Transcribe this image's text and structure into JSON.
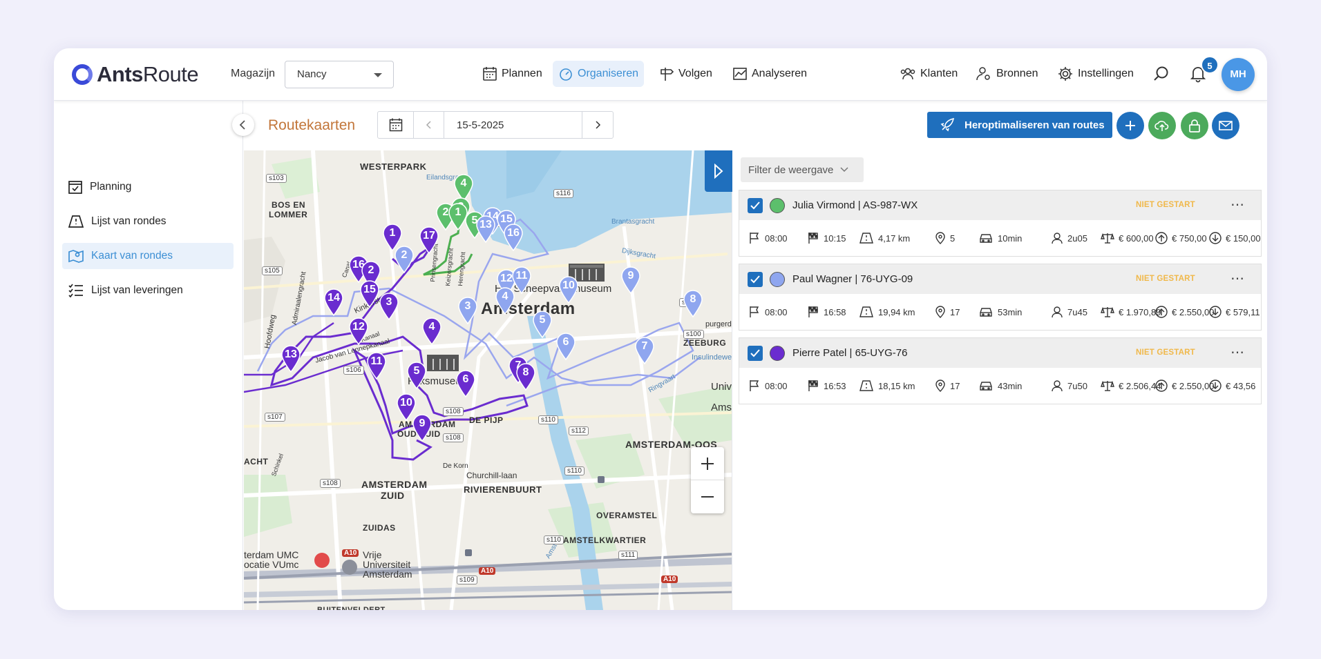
{
  "app": {
    "logo_bold": "Ants",
    "logo_light": "Route"
  },
  "header": {
    "magazijn_label": "Magazijn",
    "magazijn_value": "Nancy",
    "nav": [
      {
        "label": "Plannen",
        "icon": "calendar-icon"
      },
      {
        "label": "Organiseren",
        "icon": "gauge-icon",
        "active": true
      },
      {
        "label": "Volgen",
        "icon": "signpost-icon"
      },
      {
        "label": "Analyseren",
        "icon": "chart-icon"
      }
    ],
    "right_nav": [
      {
        "label": "Klanten",
        "icon": "users-icon"
      },
      {
        "label": "Bronnen",
        "icon": "user-gear-icon"
      },
      {
        "label": "Instellingen",
        "icon": "gear-icon"
      }
    ],
    "notification_count": "5",
    "avatar_initials": "MH",
    "accent": "#1f6fbd"
  },
  "sidebar": {
    "items": [
      {
        "label": "Planning",
        "icon": "calendar-check-icon"
      },
      {
        "label": "Lijst van rondes",
        "icon": "map-tent-icon"
      },
      {
        "label": "Kaart van rondes",
        "icon": "map-icon",
        "active": true
      },
      {
        "label": "Lijst van leveringen",
        "icon": "checklist-icon"
      }
    ]
  },
  "toolbar": {
    "title": "Routekaarten",
    "date": "15-5-2025",
    "reoptimize_label": "Heroptimaliseren van routes",
    "action_buttons": [
      {
        "icon": "plus-icon",
        "color": "#1f6fbd"
      },
      {
        "icon": "cloud-upload-icon",
        "color": "#4caa5c"
      },
      {
        "icon": "lock-icon",
        "color": "#4caa5c"
      },
      {
        "icon": "mail-icon",
        "color": "#1f6fbd"
      }
    ]
  },
  "map": {
    "labels": {
      "westerpark": "WESTERPARK",
      "bos1": "BOS EN",
      "bos2": "LOMMER",
      "amsterdam": "Amsterdam",
      "scheepvaart": "Het Scheepvaartmuseum",
      "rijks": "Rijksmuseum",
      "zuid1": "AMSTERDAM",
      "zuid2": "ZUID",
      "azuid1": "AMSTERDAM",
      "azuid2": "OUD-ZUID",
      "depijp": "DE PIJP",
      "oost": "AMSTERDAM-OOS",
      "rivier": "RIVIERENBUURT",
      "zuidas": "ZUIDAS",
      "overamstel": "OVERAMSTEL",
      "amstelkw": "AMSTELKWARTIER",
      "vu1": "Vrije",
      "vu2": "Universiteit",
      "vu3": "Amsterdam",
      "umc1": "terdam UMC",
      "umc2": "ocatie VUmc",
      "zeeburg": "ZEEBURG",
      "churchill": "Churchill-laan",
      "brantas": "Brantasgracht",
      "dijks": "Dijksgracht",
      "insulinde": "Insulindeweg",
      "ringvaart": "Ringvaart",
      "buitenveldert": "BUITENVELDERT",
      "amstel": "Amstel",
      "eilands": "Eilandsgracht",
      "acht": "ACHT",
      "univ": "Univ",
      "ams": "Ams",
      "purgerdi": "purgerdi",
      "hoofdweg": "Hoofdweg",
      "admiraal": "Admiraalengracht",
      "jvl": "Jacob van Lennepkanaal",
      "kinker": "Kinkerstraat",
      "dekorn": "De Korn",
      "schinkel": "Schinkel",
      "prinsen": "Prinsengracht",
      "keizers": "Keizersgracht",
      "heren": "Herengracht",
      "canal": "Canal",
      "kanaal": "Kanaal"
    },
    "roads": [
      "s103",
      "s105",
      "s106",
      "s107",
      "s108",
      "s108",
      "s108",
      "s109",
      "s110",
      "s110",
      "s110",
      "s112",
      "s114",
      "s116",
      "s100",
      "s100",
      "s111",
      "A10",
      "A10",
      "A10"
    ],
    "green_markers": [
      "4",
      "3",
      "2",
      "1",
      "5"
    ],
    "light_markers": [
      "14",
      "13",
      "15",
      "16",
      "2",
      "12",
      "11",
      "4",
      "3",
      "10",
      "9",
      "5",
      "6",
      "7",
      "8"
    ],
    "purple_markers": [
      "1",
      "17",
      "16",
      "2",
      "15",
      "14",
      "3",
      "4",
      "12",
      "13",
      "11",
      "5",
      "6",
      "7",
      "8",
      "10",
      "9"
    ]
  },
  "panel": {
    "filter_label": "Filter de weergave",
    "routes": [
      {
        "name": "Julia Virmond | AS-987-WX",
        "color": "#5cbf6c",
        "status": "NIET GESTART",
        "start": "08:00",
        "end": "10:15",
        "distance": "4,17 km",
        "stops": "5",
        "drive": "10min",
        "work": "2u05",
        "balance": "€ 600,00",
        "up": "€ 750,00",
        "down": "€ 150,00"
      },
      {
        "name": "Paul Wagner | 76-UYG-09",
        "color": "#8fa6ef",
        "status": "NIET GESTART",
        "start": "08:00",
        "end": "16:58",
        "distance": "19,94 km",
        "stops": "17",
        "drive": "53min",
        "work": "7u45",
        "balance": "€ 1.970,89",
        "up": "€ 2.550,00",
        "down": "€ 579,11"
      },
      {
        "name": "Pierre Patel | 65-UYG-76",
        "color": "#6a2ccf",
        "status": "NIET GESTART",
        "start": "08:00",
        "end": "16:53",
        "distance": "18,15 km",
        "stops": "17",
        "drive": "43min",
        "work": "7u50",
        "balance": "€ 2.506,44",
        "up": "€ 2.550,00",
        "down": "€ 43,56"
      }
    ]
  }
}
